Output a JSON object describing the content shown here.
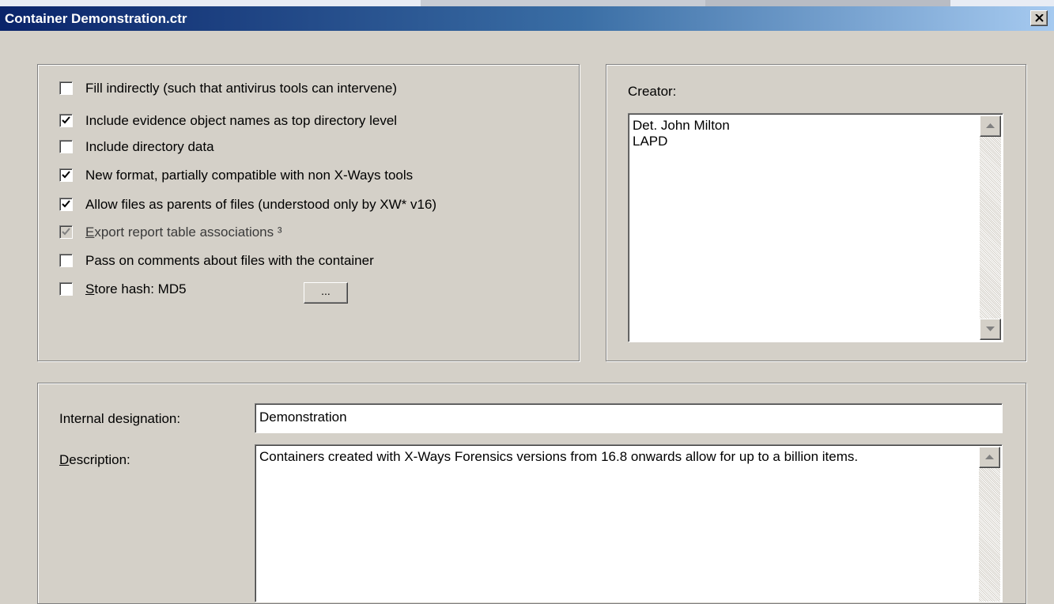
{
  "window": {
    "title": "Container Demonstration.ctr"
  },
  "options": [
    {
      "label": "Fill indirectly (such that antivirus tools can intervene)",
      "checked": false,
      "disabled": false
    },
    {
      "label": "Include evidence object names as top directory level",
      "checked": true,
      "disabled": false
    },
    {
      "label": "Include directory data",
      "checked": false,
      "disabled": false
    },
    {
      "label": "New format, partially compatible with non X-Ways tools",
      "checked": true,
      "disabled": false
    },
    {
      "label": "Allow files as parents of files (understood only by XW* v16)",
      "checked": true,
      "disabled": false
    },
    {
      "label_hotkey": "E",
      "label_rest": "xport report table associations ³",
      "checked": true,
      "disabled": true
    },
    {
      "label": "Pass on comments about files with the container",
      "checked": false,
      "disabled": false
    },
    {
      "label_hotkey": "S",
      "label_rest": "tore hash: MD5",
      "checked": false,
      "disabled": false
    }
  ],
  "hash_button": {
    "label": "..."
  },
  "creator": {
    "label": "Creator:",
    "value": "Det. John Milton\nLAPD"
  },
  "internal_designation": {
    "label": "Internal designation:",
    "value": "Demonstration"
  },
  "description": {
    "label_hotkey": "D",
    "label_rest": "escription:",
    "value": "Containers created with X-Ways Forensics versions from 16.8 onwards allow for up to a billion items."
  }
}
